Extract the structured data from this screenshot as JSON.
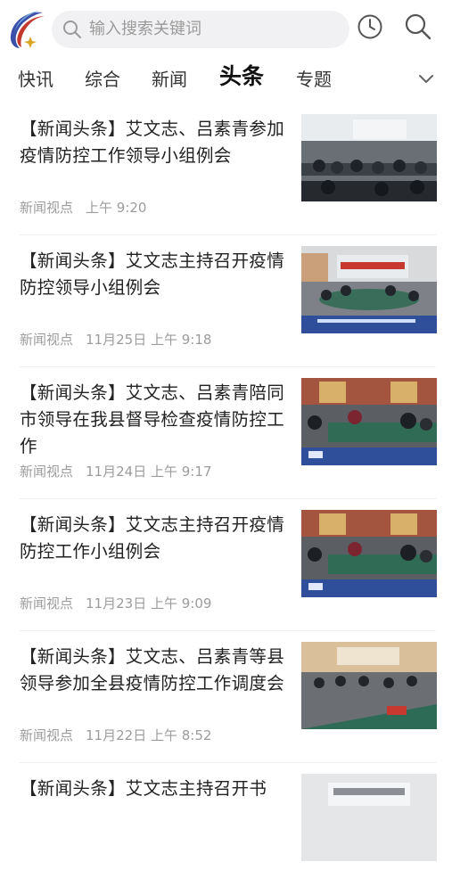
{
  "search": {
    "placeholder": "输入搜索关键词"
  },
  "tabs": [
    {
      "label": "快讯"
    },
    {
      "label": "综合"
    },
    {
      "label": "新闻"
    },
    {
      "label": "头条"
    },
    {
      "label": "专题"
    }
  ],
  "active_tab": "头条",
  "articles": [
    {
      "title": "【新闻头条】艾文志、吕素青参加疫情防控工作领导小组例会",
      "source": "新闻视点",
      "time": "上午 9:20"
    },
    {
      "title": "【新闻头条】艾文志主持召开疫情防控领导小组例会",
      "source": "新闻视点",
      "time": "11月25日 上午 9:18"
    },
    {
      "title": "【新闻头条】艾文志、吕素青陪同市领导在我县督导检查疫情防控工作",
      "source": "新闻视点",
      "time": "11月24日 上午 9:17"
    },
    {
      "title": "【新闻头条】艾文志主持召开疫情防控工作小组例会",
      "source": "新闻视点",
      "time": "11月23日 上午 9:09"
    },
    {
      "title": "【新闻头条】艾文志、吕素青等县领导参加全县疫情防控工作调度会",
      "source": "新闻视点",
      "time": "11月22日 上午 8:52"
    },
    {
      "title": "【新闻头条】艾文志主持召开书",
      "source": "",
      "time": ""
    }
  ],
  "colors": {
    "accent": "#2f5fb3",
    "text": "#222222",
    "meta": "#9c9c9c",
    "search_bg": "#f1f1f3"
  }
}
